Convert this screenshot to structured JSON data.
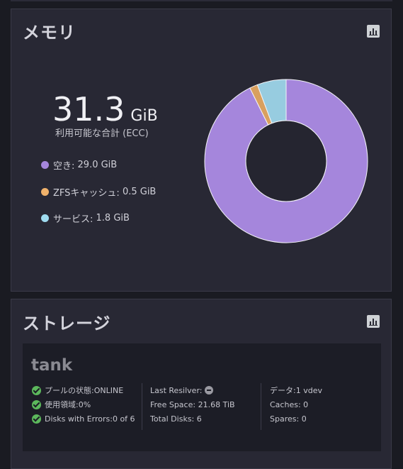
{
  "memory": {
    "title": "メモリ",
    "total_value": "31.3",
    "total_unit": "GiB",
    "total_label": "利用可能な合計 (ECC)",
    "legend": [
      {
        "label": "空き:",
        "value": "29.0 GiB",
        "color": "#a586dc"
      },
      {
        "label": "ZFSキャッシュ:",
        "value": "0.5 GiB",
        "color": "#f0b26b"
      },
      {
        "label": "サービス:",
        "value": "1.8 GiB",
        "color": "#9fdcf0"
      }
    ]
  },
  "chart_data": {
    "type": "pie",
    "categories": [
      "空き",
      "ZFSキャッシュ",
      "サービス"
    ],
    "values": [
      29.0,
      0.5,
      1.8
    ],
    "unit": "GiB",
    "colors": [
      "#a586dc",
      "#d9a05e",
      "#97cce0"
    ]
  },
  "storage": {
    "title": "ストレージ",
    "pool": {
      "name": "tank",
      "col1": [
        {
          "label": "プールの状態:",
          "value": "ONLINE"
        },
        {
          "label": "使用領域:",
          "value": "0%"
        },
        {
          "label": "Disks with Errors:",
          "value": "0 of 6"
        }
      ],
      "col2": [
        {
          "label": "Last Resilver:",
          "value": ""
        },
        {
          "label": "Free Space:",
          "value": "21.68 TiB"
        },
        {
          "label": "Total Disks:",
          "value": "6"
        }
      ],
      "col3": [
        {
          "label": "データ:",
          "value": "1 vdev"
        },
        {
          "label": "Caches:",
          "value": "0"
        },
        {
          "label": "Spares:",
          "value": "0"
        }
      ]
    }
  }
}
